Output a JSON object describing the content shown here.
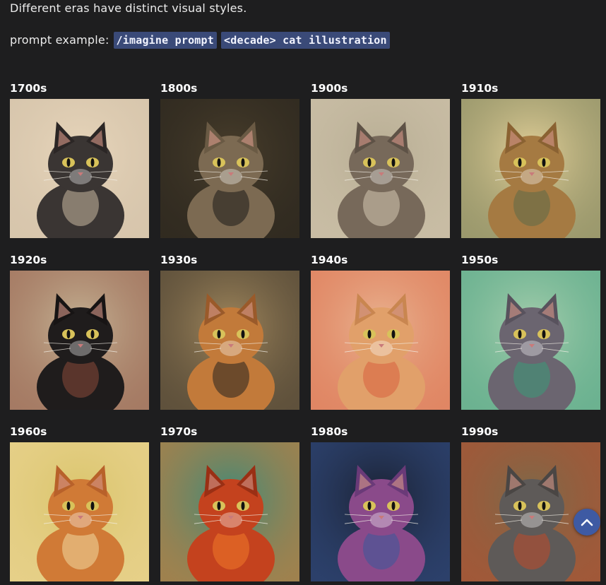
{
  "intro_text": "Different eras have distinct visual styles.",
  "prompt_label": "prompt example:",
  "prompt_codes": [
    "/imagine prompt",
    "<decade> cat illustration"
  ],
  "decades": [
    {
      "label": "1700s",
      "bg": "#e8d6bb",
      "fur": "#3a3533",
      "accent": "#c9b8a0",
      "ear": "#2b2625"
    },
    {
      "label": "1800s",
      "bg": "#4a3f2c",
      "fur": "#7c6a52",
      "accent": "#1c1a17",
      "ear": "#6a5a44"
    },
    {
      "label": "1900s",
      "bg": "#b7ad93",
      "fur": "#77695a",
      "accent": "#d6c9b2",
      "ear": "#5e5246"
    },
    {
      "label": "1910s",
      "bg": "#e6d29a",
      "fur": "#a57a42",
      "accent": "#5e6a48",
      "ear": "#8a6232"
    },
    {
      "label": "1920s",
      "bg": "#c6b596",
      "fur": "#1f1c1c",
      "accent": "#8a4a3a",
      "ear": "#171414"
    },
    {
      "label": "1930s",
      "bg": "#a48a5e",
      "fur": "#c27a3a",
      "accent": "#26221f",
      "ear": "#9a5a2a"
    },
    {
      "label": "1940s",
      "bg": "#e9b592",
      "fur": "#e1a06a",
      "accent": "#d9603e",
      "ear": "#c98650"
    },
    {
      "label": "1950s",
      "bg": "#a8cfae",
      "fur": "#6b6570",
      "accent": "#3a9a78",
      "ear": "#58525d"
    },
    {
      "label": "1960s",
      "bg": "#d9c46a",
      "fur": "#d07a36",
      "accent": "#f0d9a0",
      "ear": "#b8612a"
    },
    {
      "label": "1970s",
      "bg": "#3c8a7a",
      "fur": "#c4421e",
      "accent": "#f07a2a",
      "ear": "#9a2f14"
    },
    {
      "label": "1980s",
      "bg": "#1a2030",
      "fur": "#8a4a8a",
      "accent": "#3a5a9a",
      "ear": "#6a3a78"
    },
    {
      "label": "1990s",
      "bg": "#7a6a4a",
      "fur": "#5e5a58",
      "accent": "#c04a2a",
      "ear": "#4a4644"
    }
  ],
  "scroll_top_icon": "chevron-up-icon"
}
